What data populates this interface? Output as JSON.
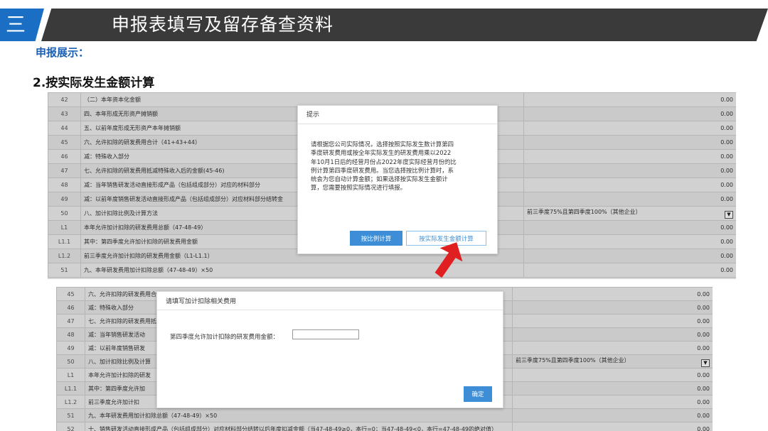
{
  "banner": {
    "number": "三",
    "title": "申报表填写及留存备查资料"
  },
  "subheading": "申报展示：",
  "section_title": "2.按实际发生金额计算",
  "table1": {
    "rows": [
      {
        "num": "42",
        "label": "（二）本年资本化金额",
        "value": "0.00"
      },
      {
        "num": "43",
        "label": "四、本年形成无形资产摊销额",
        "value": "0.00"
      },
      {
        "num": "44",
        "label": "五、以前年度形成无形资产本年摊销额",
        "value": "0.00"
      },
      {
        "num": "45",
        "label": "六、允许扣除的研发费用合计（41+43+44）",
        "value": "0.00"
      },
      {
        "num": "46",
        "label": "减：特殊收入部分",
        "value": "0.00"
      },
      {
        "num": "47",
        "label": "七、允许扣除的研发费用抵减特殊收入后的金额(45-46)",
        "value": "0.00"
      },
      {
        "num": "48",
        "label": "减：当年销售研发活动直接形成产品（包括组成部分）对应的材料部分",
        "value": "0.00"
      },
      {
        "num": "49",
        "label": "减：以前年度销售研发活动直接形成产品（包括组成部分）对应材料部分结转金",
        "value": "0.00"
      },
      {
        "num": "50",
        "label": "八、加计扣除比例及计算方法",
        "value": "",
        "select": "前三季度75%且第四季度100%（其他企业）"
      },
      {
        "num": "L1",
        "label": "本年允许加计扣除的研发费用总额（47-48-49）",
        "value": "0.00"
      },
      {
        "num": "L1.1",
        "label": "其中：第四季度允许加计扣除的研发费用金额",
        "value": "0.00"
      },
      {
        "num": "L1.2",
        "label": "前三季度允许加计扣除的研发费用金额（L1-L1.1）",
        "value": "0.00"
      },
      {
        "num": "51",
        "label": "九、本年研发费用加计扣除总额（47-48-49）×50",
        "value": "0.00"
      }
    ]
  },
  "dialog1": {
    "title": "提示",
    "body": "请根据您公司实际情况，选择按照实际发生数计算第四\n季度研发费用或按全年实际发生的研发费用乘以2022\n年10月1日后的经营月份占2022年度实际经营月份的比\n例计算第四季度研发费用。当您选择按比例计算时，系\n统会为您自动计算金额；如果选择按实际发生金额计\n算，您需要按照实际情况进行填报。",
    "ratio_button": "按比例计算",
    "actual_button": "按实际发生金额计算"
  },
  "table2": {
    "rows": [
      {
        "num": "45",
        "label": "六、允许扣除的研发费用合",
        "value": "0.00"
      },
      {
        "num": "46",
        "label": "减：特殊收入部分",
        "value": "0.00"
      },
      {
        "num": "47",
        "label": "七、允许扣除的研发费用抵",
        "value": "0.00"
      },
      {
        "num": "48",
        "label": "减：当年销售研发活动",
        "value": "0.00"
      },
      {
        "num": "49",
        "label": "减：以前年度销售研发",
        "value": "0.00"
      },
      {
        "num": "50",
        "label": "八、加计扣除比例及计算",
        "value": "",
        "select": "前三季度75%且第四季度100%（其他企业）"
      },
      {
        "num": "L1",
        "label": "本年允许加计扣除的研发",
        "value": "0.00"
      },
      {
        "num": "L1.1",
        "label": "其中：第四季度允许加",
        "value": "0.00"
      },
      {
        "num": "L1.2",
        "label": "前三季度允许加计扣",
        "value": "0.00"
      },
      {
        "num": "51",
        "label": "九、本年研发费用加计扣除总额（47-48-49）×50",
        "value": "0.00"
      },
      {
        "num": "52",
        "label": "十、销售研发活动直接形成产品（包括组成部分）对应材料部分结转以后年度扣减金额（当47-48-49≥0，本行=0；当47-48-49<0，本行=47-48-49的绝对值）",
        "value": "0.00"
      }
    ]
  },
  "dialog2": {
    "title": "请填写加计扣除相关费用",
    "field_label": "第四季度允许加计扣除的研发费用金额：",
    "field_value": "",
    "ok_button": "确定"
  },
  "colors": {
    "accent": "#1a6fc4",
    "banner_dark": "#3a3a3a",
    "button_blue": "#3d8ed6",
    "arrow_red": "#e02020"
  }
}
